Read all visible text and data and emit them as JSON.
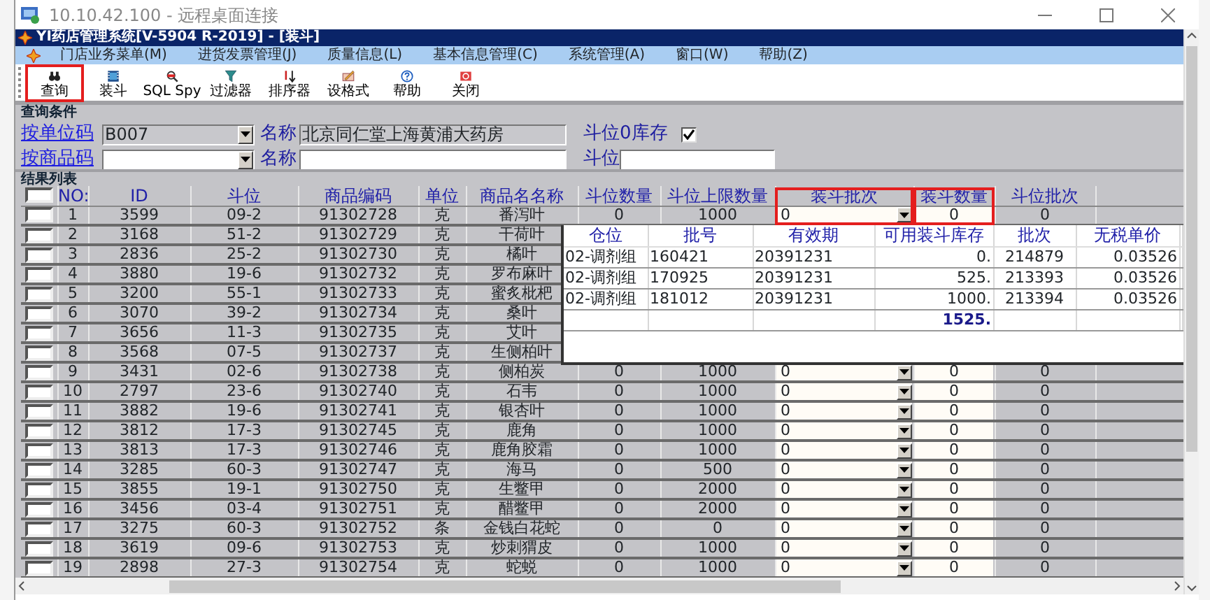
{
  "remote_window": {
    "title": "10.10.42.100 - 远程桌面连接"
  },
  "app": {
    "title": "YI药店管理系统[V-5904 R-2019] - [装斗]"
  },
  "menu": [
    "门店业务菜单(M)",
    "进货发票管理(J)",
    "质量信息(L)",
    "基本信息管理(C)",
    "系统管理(A)",
    "窗口(W)",
    "帮助(Z)"
  ],
  "toolbar": [
    {
      "label": "查询",
      "kind": "binoculars",
      "highlighted": true
    },
    {
      "label": "装斗",
      "kind": "film",
      "highlighted": false
    },
    {
      "label": "SQL Spy",
      "kind": "magnifier",
      "highlighted": false
    },
    {
      "label": "过滤器",
      "kind": "funnel",
      "highlighted": false
    },
    {
      "label": "排序器",
      "kind": "sort",
      "highlighted": false
    },
    {
      "label": "设格式",
      "kind": "pencil",
      "highlighted": false
    },
    {
      "label": "帮助",
      "kind": "help",
      "highlighted": false
    },
    {
      "label": "关闭",
      "kind": "close",
      "highlighted": false
    }
  ],
  "query": {
    "group_label": "查询条件",
    "unit_code": {
      "label": "按单位码",
      "value": "B007"
    },
    "unit_name": {
      "label": "名称",
      "value": "北京同仁堂上海黄浦大药房"
    },
    "zero_stock": {
      "label": "斗位0库存",
      "checked": true
    },
    "product_code": {
      "label": "按商品码"
    },
    "product_name": {
      "label": "名称"
    },
    "slot": {
      "label": "斗位"
    }
  },
  "results": {
    "label": "结果列表",
    "header_checked": false,
    "columns": [
      {
        "label": "NO:",
        "kind": "text",
        "highlighted": false
      },
      {
        "label": "ID",
        "kind": "text",
        "highlighted": false
      },
      {
        "label": "斗位",
        "kind": "text",
        "highlighted": false
      },
      {
        "label": "商品编码",
        "kind": "text",
        "highlighted": false
      },
      {
        "label": "单位",
        "kind": "text",
        "highlighted": false
      },
      {
        "label": "商品名名称",
        "kind": "text",
        "highlighted": false
      },
      {
        "label": "斗位数量",
        "kind": "text",
        "highlighted": false
      },
      {
        "label": "斗位上限数量",
        "kind": "text",
        "highlighted": false
      },
      {
        "label": "装斗批次",
        "kind": "dropdown",
        "highlighted": true
      },
      {
        "label": "装斗数量",
        "kind": "input",
        "highlighted": true
      },
      {
        "label": "斗位批次",
        "kind": "text",
        "highlighted": false
      }
    ],
    "rows": [
      {
        "checked": false,
        "cells": [
          "1",
          "3599",
          "09-2",
          "91302728",
          "克",
          "番泻叶",
          "0",
          "1000",
          "0",
          "0",
          "0"
        ]
      },
      {
        "checked": false,
        "cells": [
          "2",
          "3168",
          "51-2",
          "91302729",
          "克",
          "干荷叶"
        ]
      },
      {
        "checked": false,
        "cells": [
          "3",
          "2836",
          "25-2",
          "91302730",
          "克",
          "橘叶"
        ]
      },
      {
        "checked": false,
        "cells": [
          "4",
          "3880",
          "19-6",
          "91302732",
          "克",
          "罗布麻叶"
        ]
      },
      {
        "checked": false,
        "cells": [
          "5",
          "3200",
          "55-1",
          "91302733",
          "克",
          "蜜炙枇杷"
        ]
      },
      {
        "checked": false,
        "cells": [
          "6",
          "3070",
          "39-2",
          "91302734",
          "克",
          "桑叶"
        ]
      },
      {
        "checked": false,
        "cells": [
          "7",
          "3656",
          "11-3",
          "91302735",
          "克",
          "艾叶"
        ]
      },
      {
        "checked": false,
        "cells": [
          "8",
          "3568",
          "07-5",
          "91302737",
          "克",
          "生侧柏叶"
        ]
      },
      {
        "checked": false,
        "cells": [
          "9",
          "3431",
          "02-6",
          "91302738",
          "克",
          "侧柏炭",
          "0",
          "1000",
          "0",
          "0",
          "0"
        ]
      },
      {
        "checked": false,
        "cells": [
          "10",
          "2797",
          "23-6",
          "91302740",
          "克",
          "石韦",
          "0",
          "1000",
          "0",
          "0",
          "0"
        ]
      },
      {
        "checked": false,
        "cells": [
          "11",
          "3882",
          "19-6",
          "91302741",
          "克",
          "银杏叶",
          "0",
          "1000",
          "0",
          "0",
          "0"
        ]
      },
      {
        "checked": false,
        "cells": [
          "12",
          "3812",
          "17-3",
          "91302745",
          "克",
          "鹿角",
          "0",
          "1000",
          "0",
          "0",
          "0"
        ]
      },
      {
        "checked": false,
        "cells": [
          "13",
          "3813",
          "17-3",
          "91302746",
          "克",
          "鹿角胶霜",
          "0",
          "1000",
          "0",
          "0",
          "0"
        ]
      },
      {
        "checked": false,
        "cells": [
          "14",
          "3285",
          "60-3",
          "91302747",
          "克",
          "海马",
          "0",
          "500",
          "0",
          "0",
          "0"
        ]
      },
      {
        "checked": false,
        "cells": [
          "15",
          "3855",
          "19-1",
          "91302750",
          "克",
          "生鳖甲",
          "0",
          "2000",
          "0",
          "0",
          "0"
        ]
      },
      {
        "checked": false,
        "cells": [
          "16",
          "3456",
          "03-4",
          "91302751",
          "克",
          "醋鳖甲",
          "0",
          "2000",
          "0",
          "0",
          "0"
        ]
      },
      {
        "checked": false,
        "cells": [
          "17",
          "3275",
          "60-3",
          "91302752",
          "条",
          "金钱白花蛇",
          "0",
          "0",
          "0",
          "0",
          "0"
        ]
      },
      {
        "checked": false,
        "cells": [
          "18",
          "3619",
          "09-6",
          "91302753",
          "克",
          "炒刺猬皮",
          "0",
          "1000",
          "0",
          "0",
          "0"
        ]
      },
      {
        "checked": false,
        "cells": [
          "19",
          "2898",
          "27-3",
          "91302754",
          "克",
          "蛇蜕",
          "0",
          "1000",
          "0",
          "0",
          "0"
        ]
      }
    ]
  },
  "batch_popup": {
    "columns": [
      "仓位",
      "批号",
      "有效期",
      "可用装斗库存",
      "批次",
      "无税单价"
    ],
    "rows": [
      [
        "02-调剂组",
        "160421",
        "20391231",
        "0.",
        "214879",
        "0.03526"
      ],
      [
        "02-调剂组",
        "170925",
        "20391231",
        "525.",
        "213393",
        "0.03526"
      ],
      [
        "02-调剂组",
        "181012",
        "20391231",
        "1000.",
        "213394",
        "0.03526"
      ]
    ],
    "total": "1525."
  }
}
